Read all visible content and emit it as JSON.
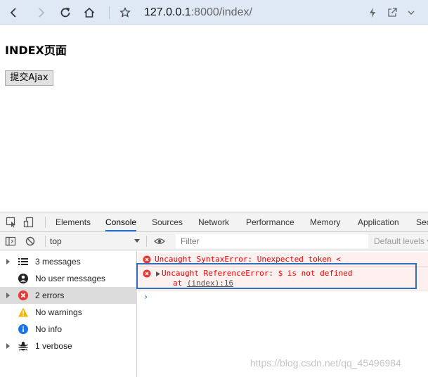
{
  "browser": {
    "url_host": "127.0.0.1",
    "url_rest": ":8000/index/"
  },
  "page": {
    "heading": "INDEX页面",
    "button_label": "提交Ajax"
  },
  "devtools": {
    "tabs": [
      "Elements",
      "Console",
      "Sources",
      "Network",
      "Performance",
      "Memory",
      "Application",
      "Sec"
    ],
    "active_tab": "Console",
    "context": "top",
    "filter_placeholder": "Filter",
    "levels": "Default levels ▾",
    "sidebar": [
      {
        "label": "3 messages",
        "icon": "list-icon"
      },
      {
        "label": "No user messages",
        "icon": "user-icon"
      },
      {
        "label": "2 errors",
        "icon": "error-icon"
      },
      {
        "label": "No warnings",
        "icon": "warning-icon"
      },
      {
        "label": "No info",
        "icon": "info-icon"
      },
      {
        "label": "1 verbose",
        "icon": "bug-icon"
      }
    ],
    "messages": [
      {
        "text": "Uncaught SyntaxError: Unexpected token <"
      },
      {
        "text": "Uncaught ReferenceError: $ is not defined",
        "at_prefix": "at ",
        "at_link": "(index):16"
      }
    ],
    "prompt": "›"
  },
  "watermark": "https://blog.csdn.net/qq_45496984",
  "colors": {
    "error": "#e00000",
    "accent": "#1a73e8",
    "highlight_box": "#2c6fbf"
  }
}
